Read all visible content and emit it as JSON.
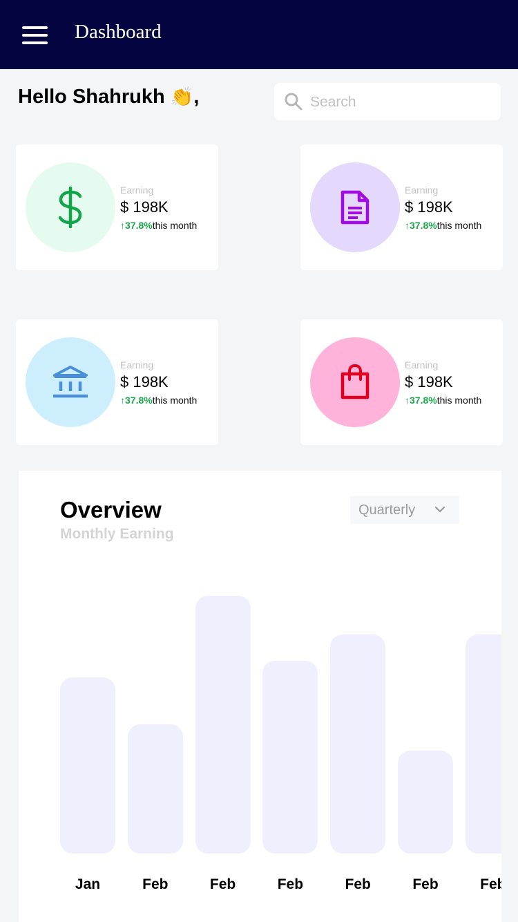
{
  "header": {
    "title": "Dashboard",
    "menu_icon": "hamburger-menu-icon"
  },
  "greeting": {
    "text": "Hello Shahrukh",
    "emoji": "👏",
    "suffix": ","
  },
  "search": {
    "placeholder": "Search",
    "icon": "search-icon"
  },
  "cards": [
    {
      "label": "Earning",
      "amount": "$ 198K",
      "change": "↑37.8%",
      "period": "this month",
      "icon": "dollar-icon",
      "icon_color": "#12a54a",
      "circle_color": "#e6fbef"
    },
    {
      "label": "Earning",
      "amount": "$ 198K",
      "change": "↑37.8%",
      "period": "this month",
      "icon": "document-icon",
      "icon_color": "#a10de0",
      "circle_color": "#e4d9fd"
    },
    {
      "label": "Earning",
      "amount": "$ 198K",
      "change": "↑37.8%",
      "period": "this month",
      "icon": "bank-icon",
      "icon_color": "#4a8fd8",
      "circle_color": "#cdeffd"
    },
    {
      "label": "Earning",
      "amount": "$ 198K",
      "change": "↑37.8%",
      "period": "this month",
      "icon": "shopping-bag-icon",
      "icon_color": "#e0001e",
      "circle_color": "#ffb3da"
    }
  ],
  "overview": {
    "title": "Overview",
    "subtitle": "Monthly Earning",
    "dropdown_value": "Quarterly"
  },
  "chart_data": {
    "type": "bar",
    "categories": [
      "Jan",
      "Feb",
      "Feb",
      "Feb",
      "Feb",
      "Feb",
      "Feb"
    ],
    "values": [
      255,
      187,
      373,
      279,
      317,
      149,
      317
    ],
    "bar_color": "#f0effd"
  }
}
